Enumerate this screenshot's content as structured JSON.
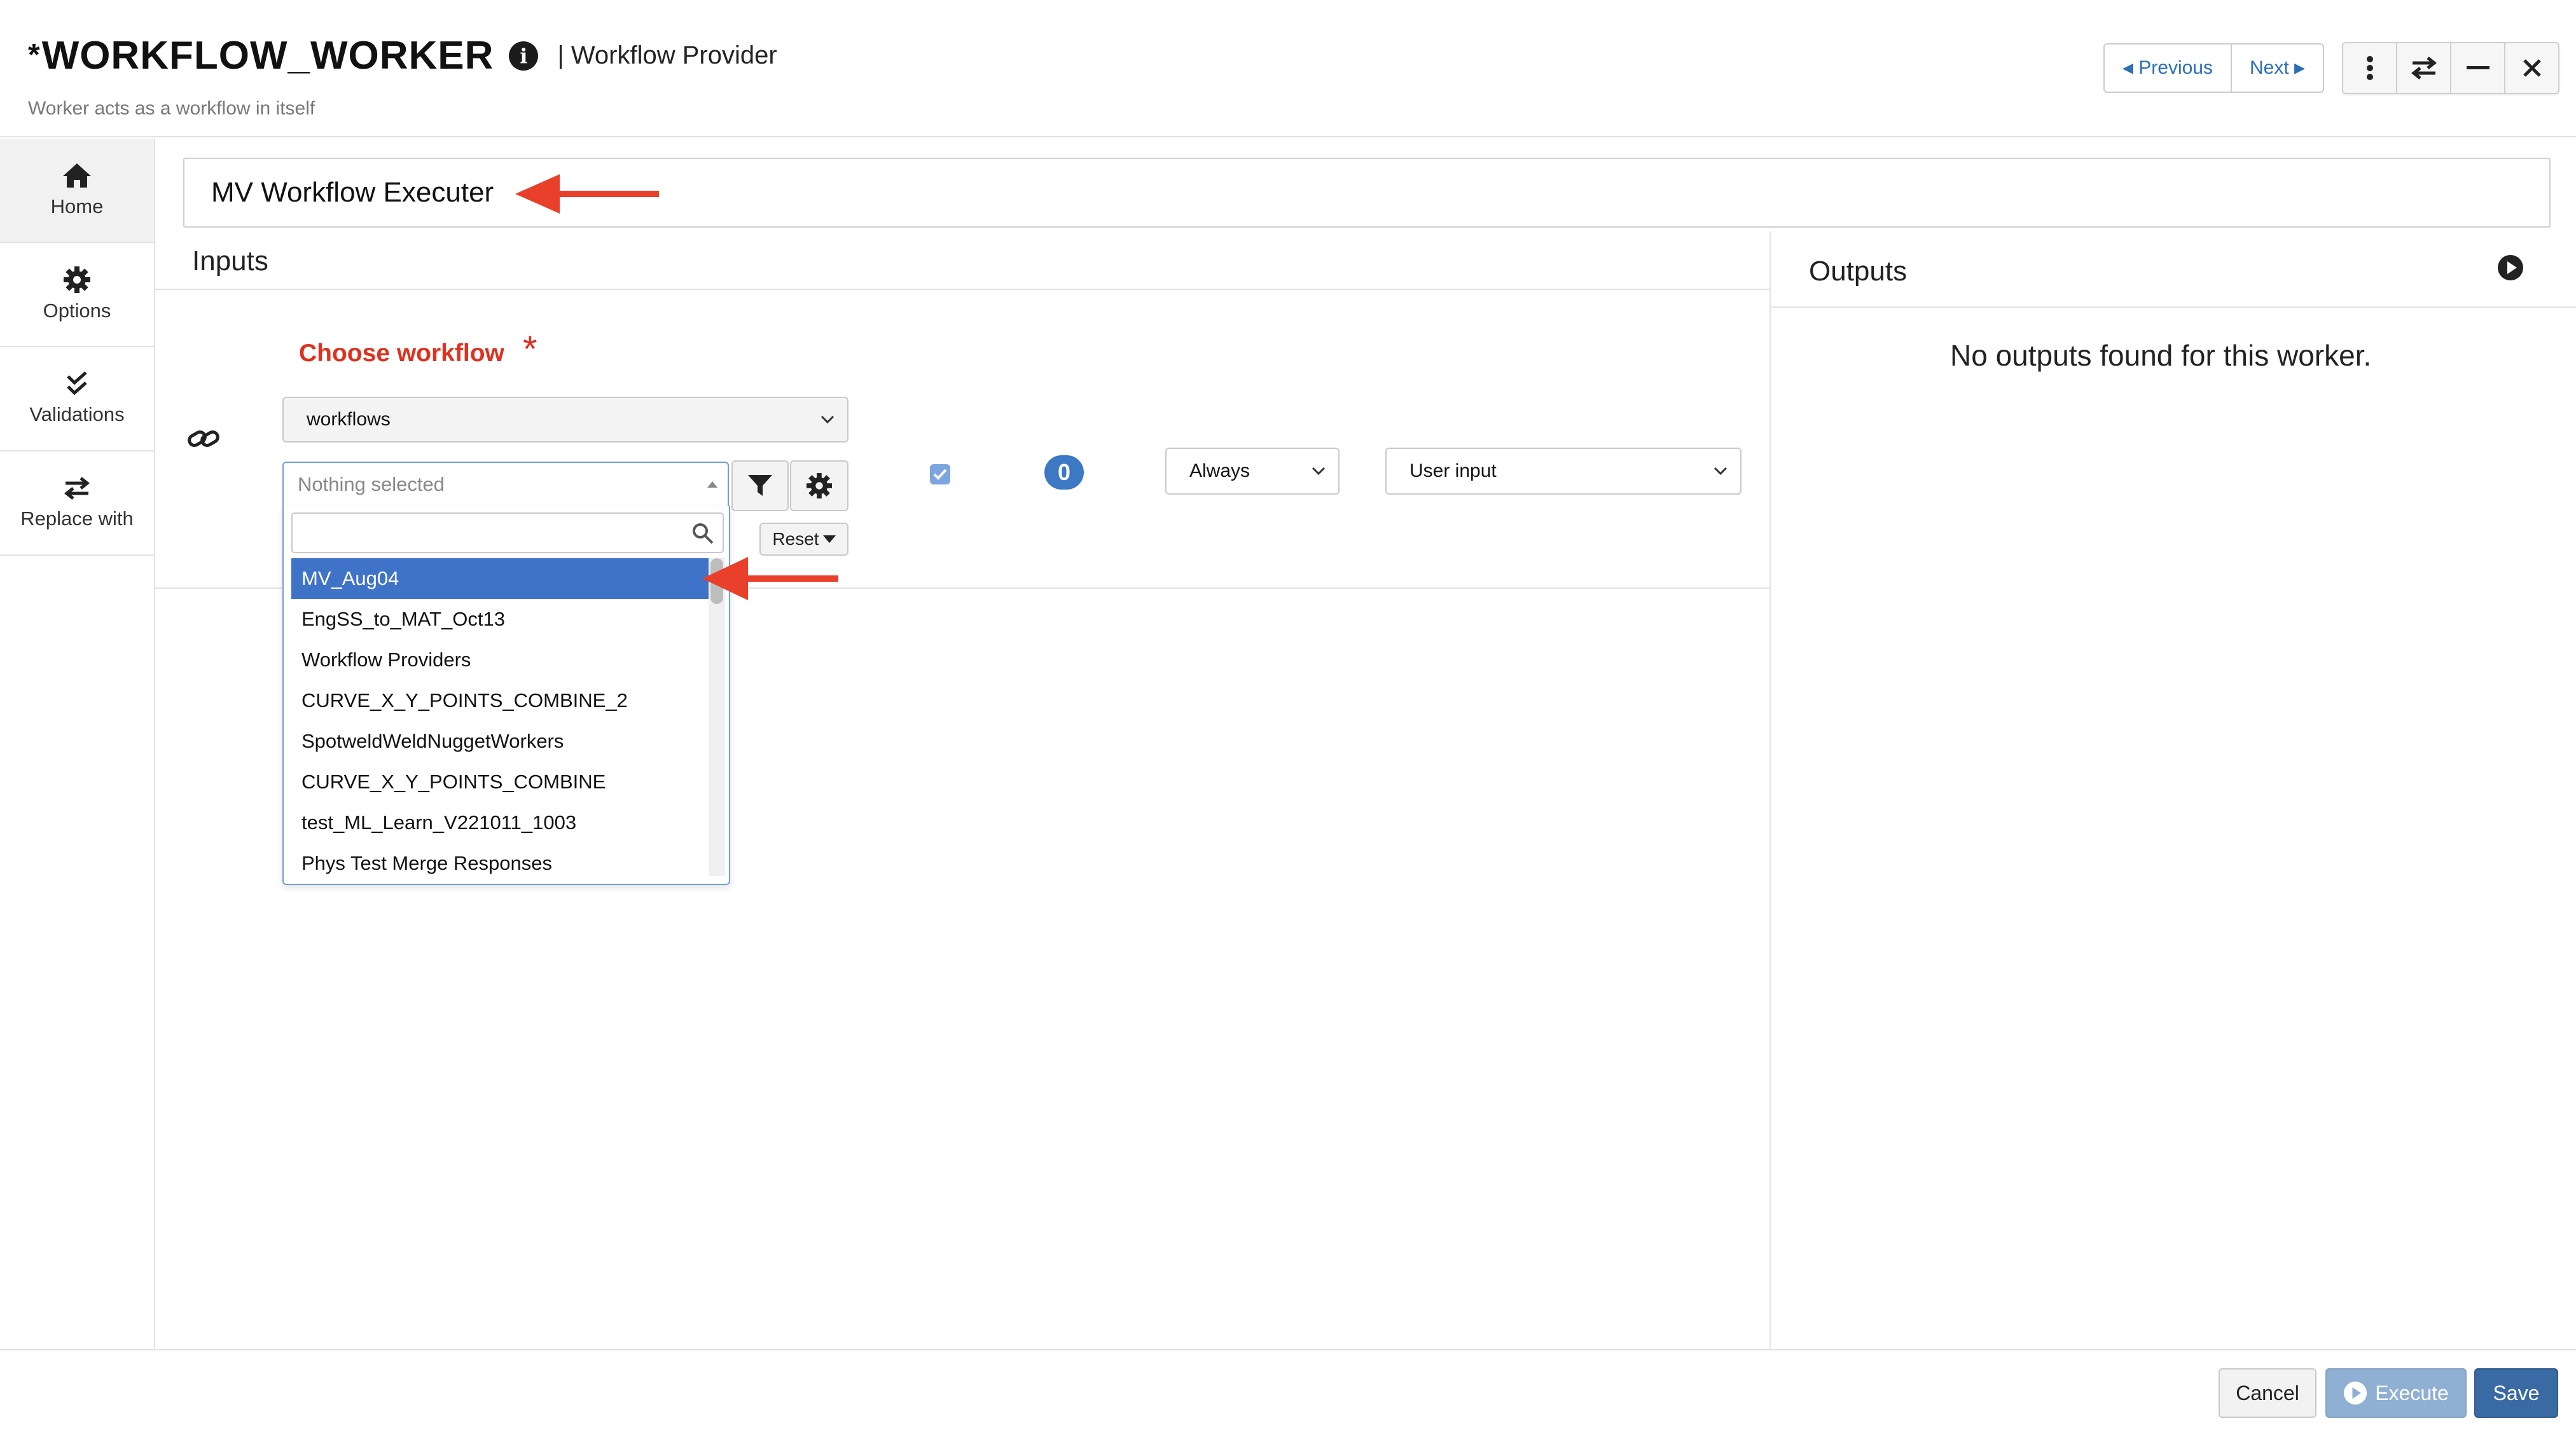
{
  "header": {
    "title_prefix": "*",
    "title": "WORKFLOW_WORKER",
    "type_label": "| Workflow Provider",
    "description": "Worker acts as a workflow in itself",
    "prev_label": "Previous",
    "next_label": "Next"
  },
  "sidebar": {
    "items": [
      {
        "label": "Home",
        "icon": "home-icon"
      },
      {
        "label": "Options",
        "icon": "gear-icon"
      },
      {
        "label": "Validations",
        "icon": "check-double-icon"
      },
      {
        "label": "Replace with",
        "icon": "exchange-icon"
      }
    ]
  },
  "worker_name": "MV Workflow Executer",
  "inputs": {
    "heading": "Inputs",
    "choose_label": "Choose workflow",
    "required_mark": "*",
    "category_select": "workflows",
    "workflow_placeholder": "Nothing selected",
    "reset_label": "Reset",
    "enabled_checked": true,
    "count": "0",
    "condition_select": "Always",
    "source_select": "User input",
    "dropdown": {
      "search_value": "",
      "options": [
        "MV_Aug04",
        "EngSS_to_MAT_Oct13",
        "Workflow Providers",
        "CURVE_X_Y_POINTS_COMBINE_2",
        "SpotweldWeldNuggetWorkers",
        "CURVE_X_Y_POINTS_COMBINE",
        "test_ML_Learn_V221011_1003",
        "Phys Test Merge Responses"
      ],
      "highlighted": "MV_Aug04"
    }
  },
  "outputs": {
    "heading": "Outputs",
    "empty_message": "No outputs found for this worker."
  },
  "footer": {
    "cancel_label": "Cancel",
    "execute_label": "Execute",
    "save_label": "Save"
  },
  "colors": {
    "required": "#e0301e",
    "highlight": "#3f73c8",
    "annotation_arrow": "#e8402a",
    "link": "#2a6fb6",
    "save": "#3a6aa3"
  }
}
